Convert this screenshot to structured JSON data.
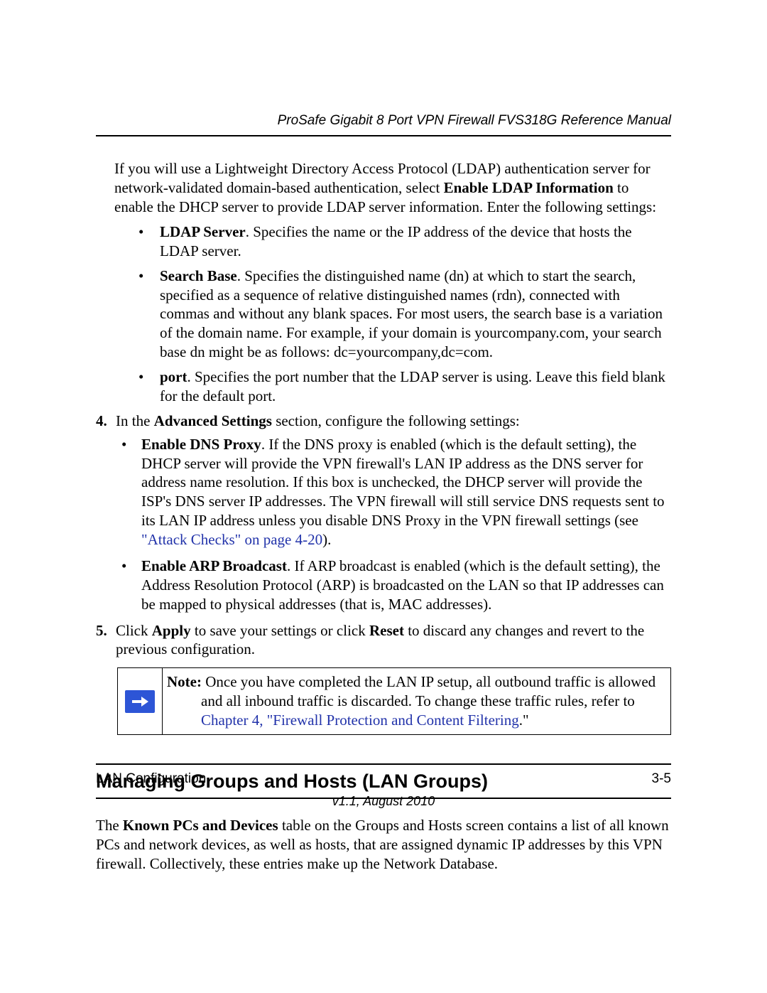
{
  "header": {
    "title": "ProSafe Gigabit 8 Port VPN Firewall FVS318G Reference Manual"
  },
  "body": {
    "intro_1": "If you will use a Lightweight Directory Access Protocol (LDAP) authentication server for network-validated domain-based authentication, select ",
    "intro_bold": "Enable LDAP Information",
    "intro_2": " to enable the DHCP server to provide LDAP server information. Enter the following settings:",
    "ldap_server_bold": "LDAP Server",
    "ldap_server_text": ". Specifies the name or the IP address of the device that hosts the LDAP server.",
    "search_base_bold": "Search Base",
    "search_base_text": ". Specifies the distinguished name (dn) at which to start the search, specified as a sequence of relative distinguished names (rdn), connected with commas and without any blank spaces. For most users, the search base is a variation of the domain name. For example, if your domain is yourcompany.com, your search base dn might be as follows: dc=yourcompany,dc=com.",
    "port_bold": "port",
    "port_text": ". Specifies the port number that the LDAP server is using. Leave this field blank for the default port.",
    "step4_num": "4.",
    "step4_a": "In the ",
    "step4_bold": "Advanced Settings",
    "step4_b": " section, configure the following settings:",
    "dns_bold": "Enable DNS Proxy",
    "dns_text_a": ". If the DNS proxy is enabled (which is the default setting), the DHCP server will provide the VPN firewall's LAN IP address as the DNS server for address name resolution. If this box is unchecked, the DHCP server will provide the ISP's DNS server IP addresses. The VPN firewall will still service DNS requests sent to its LAN IP address unless you disable DNS Proxy in the VPN firewall settings (see ",
    "dns_link": "\"Attack Checks\" on page 4-20",
    "dns_text_b": ").",
    "arp_bold": "Enable ARP Broadcast",
    "arp_text": ". If ARP broadcast is enabled (which is the default setting), the Address Resolution Protocol (ARP) is broadcasted on the LAN so that IP addresses can be mapped to physical addresses (that is, MAC addresses).",
    "step5_num": "5.",
    "step5_a": "Click ",
    "step5_bold1": "Apply",
    "step5_b": " to save your settings or click ",
    "step5_bold2": "Reset",
    "step5_c": " to discard any changes and revert to the previous configuration.",
    "note_bold": "Note:",
    "note_line1": " Once you have completed the LAN IP setup, all outbound traffic is allowed",
    "note_line2": "and all inbound traffic is discarded. To change these traffic rules, refer to ",
    "note_link": "Chapter 4, \"Firewall Protection and Content Filtering",
    "note_after_link": ".\"",
    "h2": "Managing Groups and Hosts (LAN Groups)",
    "after_h2_a": "The ",
    "after_h2_bold": "Known PCs and Devices",
    "after_h2_b": " table on the Groups and Hosts screen contains a list of all known PCs and network devices, as well as hosts, that are assigned dynamic IP addresses by this VPN firewall. Collectively, these entries make up the Network Database."
  },
  "footer": {
    "section": "LAN Configuration",
    "pagenum": "3-5",
    "version": "v1.1, August 2010"
  }
}
